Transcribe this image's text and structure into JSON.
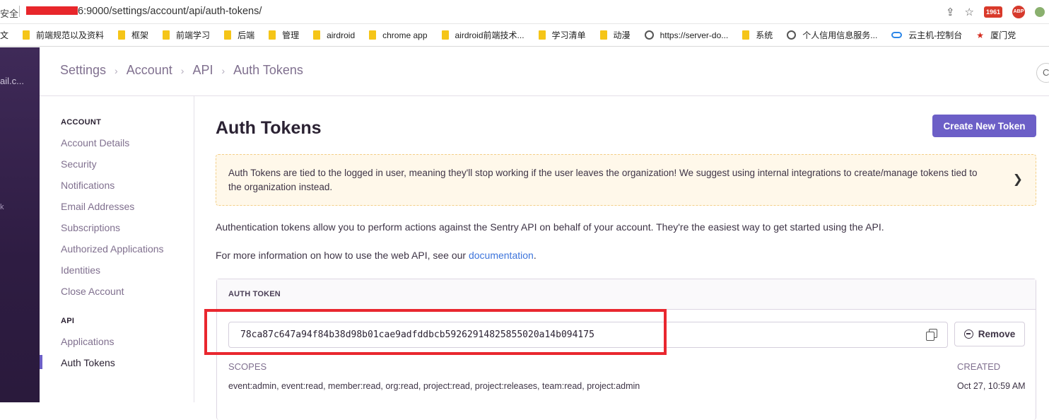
{
  "browser": {
    "security_label": "安全",
    "url": "6:9000/settings/account/api/auth-tokens/",
    "icons": [
      "share-icon",
      "bookmark-star-icon",
      "mail-extension-icon",
      "adblock-extension-icon",
      "extension-icon"
    ],
    "mail_badge": "1961",
    "abp_label": "ABP",
    "bookmarks": [
      {
        "label": "杂文",
        "icon": "folder"
      },
      {
        "label": "前端规范以及资料",
        "icon": "folder"
      },
      {
        "label": "框架",
        "icon": "folder"
      },
      {
        "label": "前端学习",
        "icon": "folder"
      },
      {
        "label": "后端",
        "icon": "folder"
      },
      {
        "label": "管理",
        "icon": "folder"
      },
      {
        "label": "airdroid",
        "icon": "folder"
      },
      {
        "label": "chrome app",
        "icon": "folder"
      },
      {
        "label": "airdroid前端技术...",
        "icon": "folder"
      },
      {
        "label": "学习清单",
        "icon": "folder"
      },
      {
        "label": "动漫",
        "icon": "folder"
      },
      {
        "label": "https://server-do...",
        "icon": "globe"
      },
      {
        "label": "系统",
        "icon": "folder"
      },
      {
        "label": "个人信用信息服务...",
        "icon": "globe"
      },
      {
        "label": "云主机-控制台",
        "icon": "cloud"
      },
      {
        "label": "厦门党",
        "icon": "star"
      }
    ]
  },
  "rail": {
    "org_text": "ail.c..."
  },
  "header": {
    "breadcrumb": [
      "Settings",
      "Account",
      "API",
      "Auth Tokens"
    ],
    "right_button": "C"
  },
  "sidenav": {
    "account_heading": "ACCOUNT",
    "account_items": [
      "Account Details",
      "Security",
      "Notifications",
      "Email Addresses",
      "Subscriptions",
      "Authorized Applications",
      "Identities",
      "Close Account"
    ],
    "api_heading": "API",
    "api_items": [
      "Applications",
      "Auth Tokens"
    ]
  },
  "main": {
    "title": "Auth Tokens",
    "create_button": "Create New Token",
    "alert_text": "Auth Tokens are tied to the logged in user, meaning they'll stop working if the user leaves the organization! We suggest using internal integrations to create/manage tokens tied to the organization instead.",
    "description": "Authentication tokens allow you to perform actions against the Sentry API on behalf of your account. They're the easiest way to get started using the API.",
    "more_info_prefix": "For more information on how to use the web API, see our ",
    "more_info_link": "documentation",
    "more_info_suffix": ".",
    "panel_heading": "AUTH TOKEN",
    "token": "78ca87c647a94f84b38d98b01cae9adfddbcb59262914825855020a14b094175",
    "remove_button": "Remove",
    "scopes_label": "SCOPES",
    "scopes_value": "event:admin, event:read, member:read, org:read, project:read, project:releases, team:read, project:admin",
    "created_label": "CREATED",
    "created_value": "Oct 27, 10:59 AM"
  },
  "colors": {
    "accent": "#6c5fc7",
    "highlight_box": "#e9272f",
    "alert_bg": "#fff8ea",
    "rail": "#3f2a58"
  }
}
